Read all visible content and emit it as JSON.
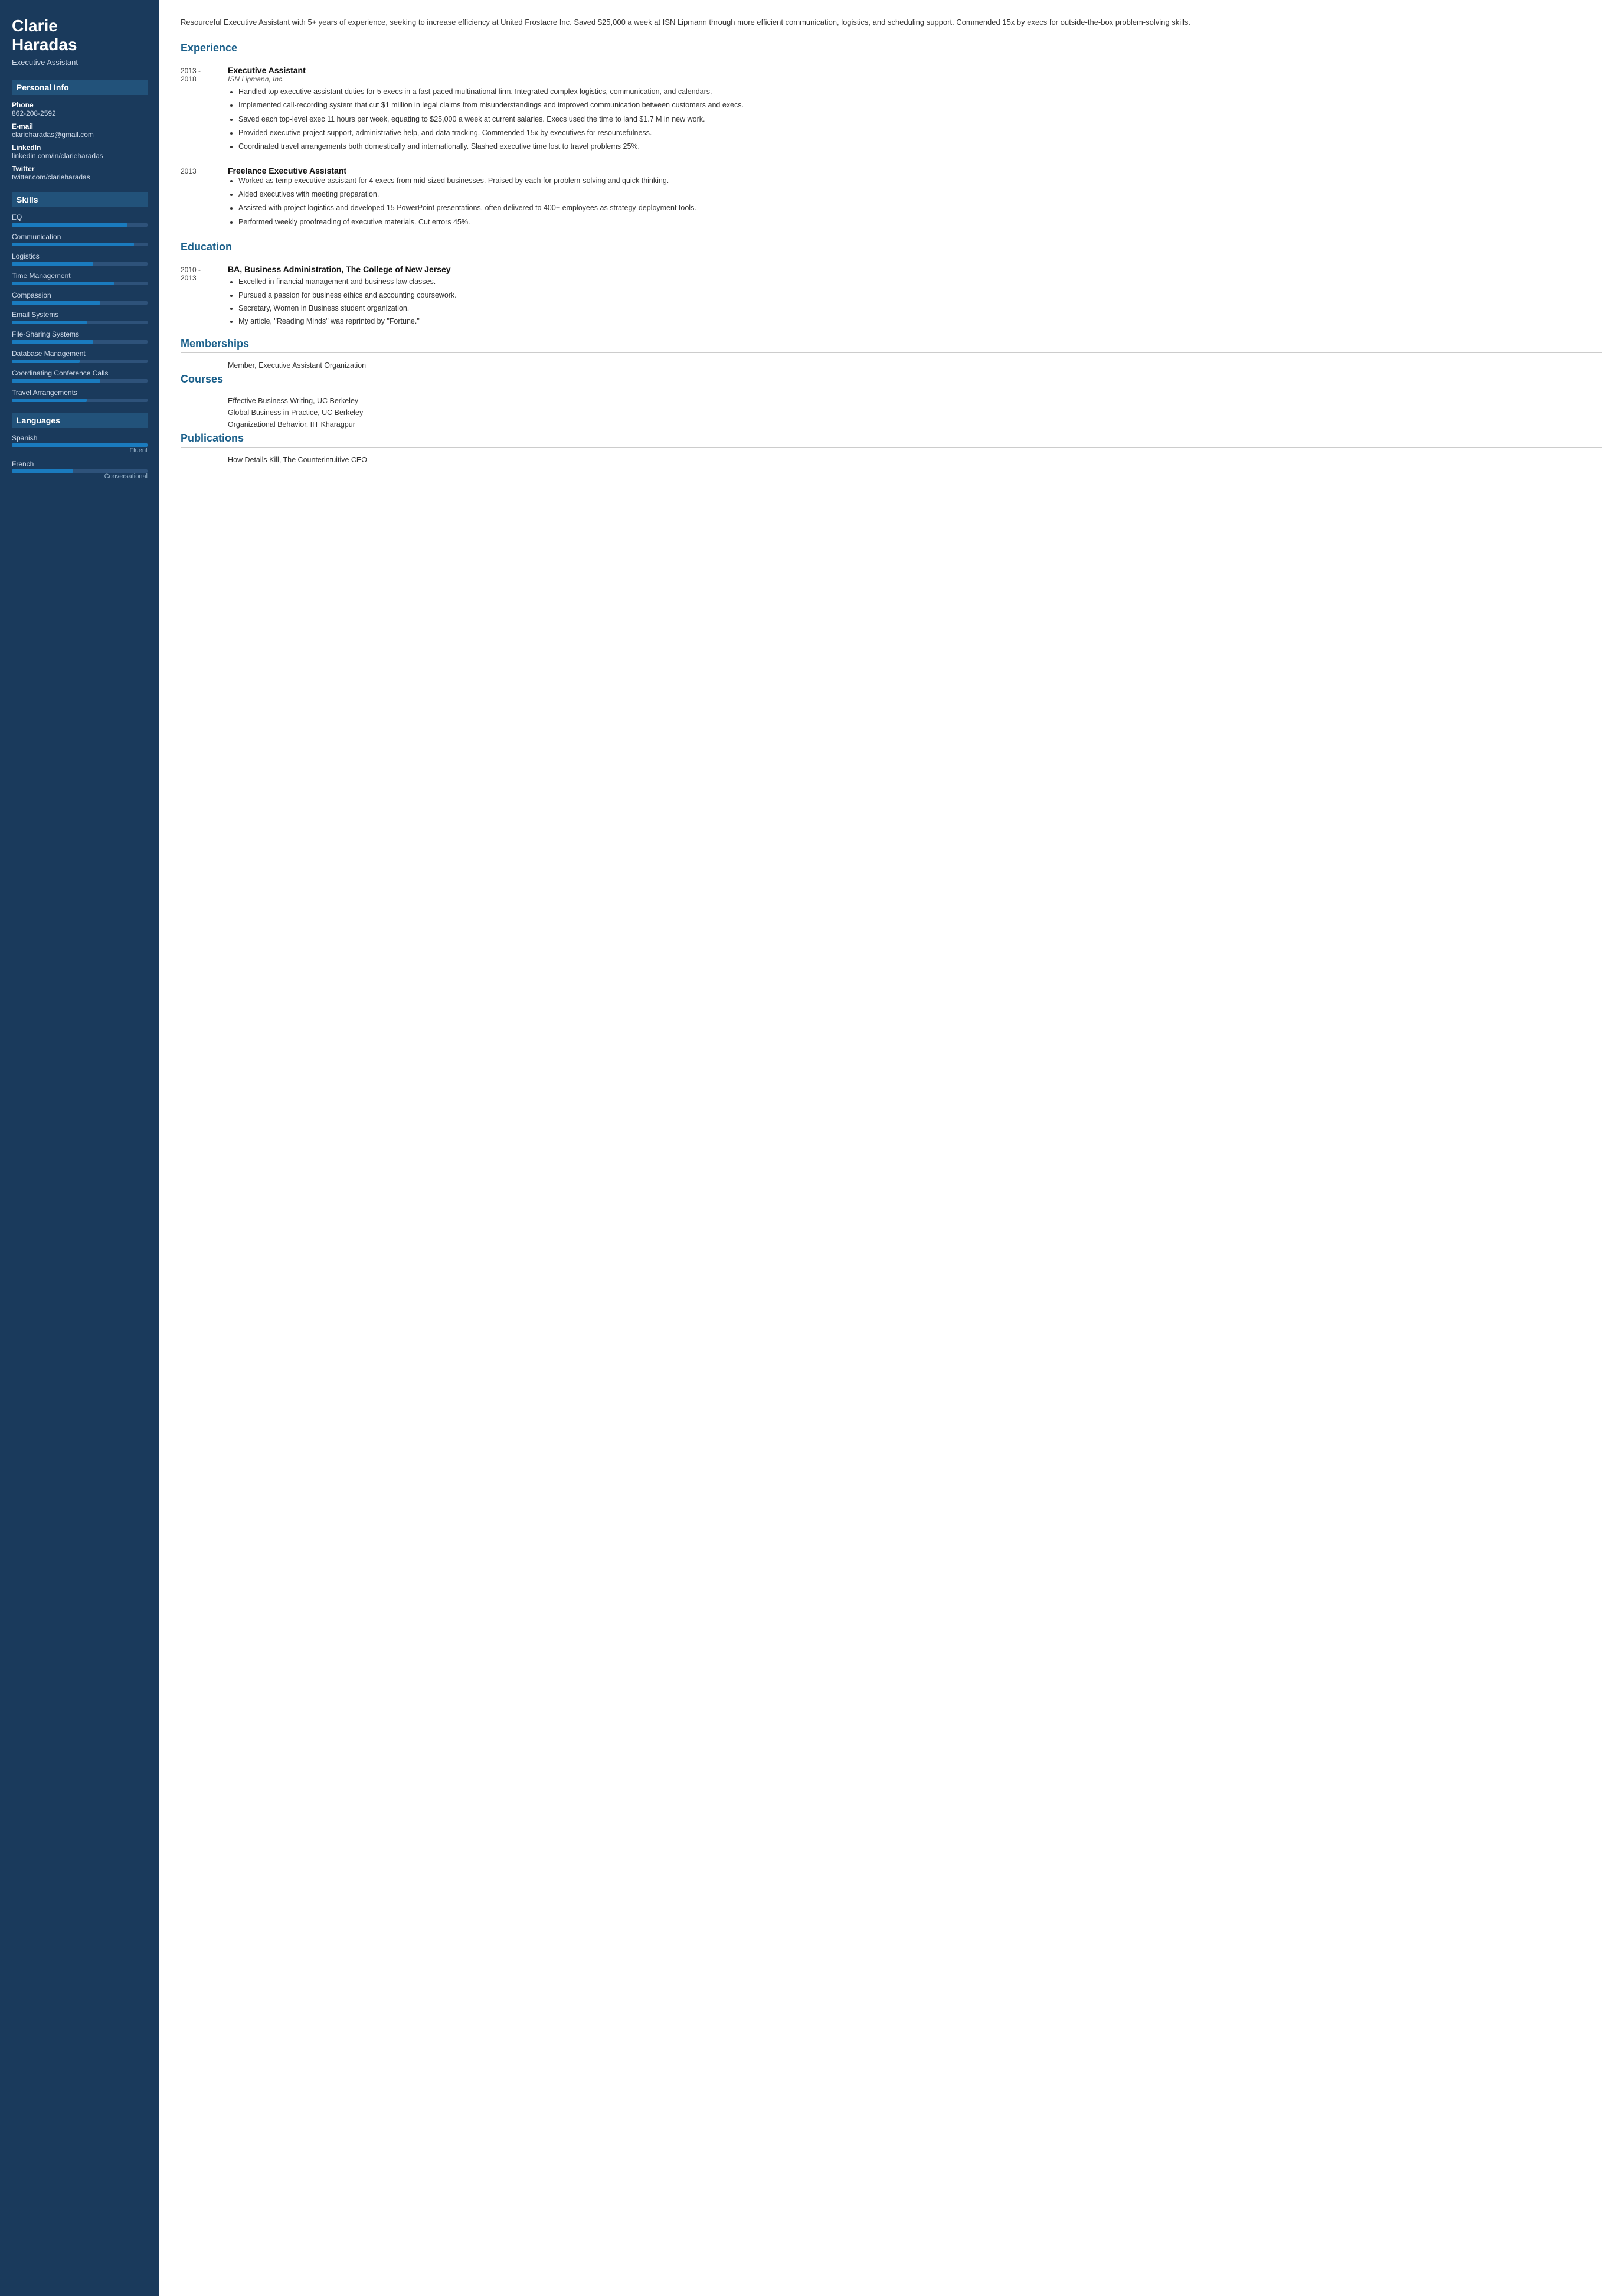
{
  "sidebar": {
    "name": "Clarie\nHaradas",
    "name_line1": "Clarie",
    "name_line2": "Haradas",
    "title": "Executive Assistant",
    "personal_info_label": "Personal Info",
    "phone_label": "Phone",
    "phone": "862-208-2592",
    "email_label": "E-mail",
    "email": "clarieharadas@gmail.com",
    "linkedin_label": "LinkedIn",
    "linkedin": "linkedin.com/in/clarieharadas",
    "twitter_label": "Twitter",
    "twitter": "twitter.com/clarieharadas",
    "skills_label": "Skills",
    "skills": [
      {
        "name": "EQ",
        "pct": 85
      },
      {
        "name": "Communication",
        "pct": 90
      },
      {
        "name": "Logistics",
        "pct": 60
      },
      {
        "name": "Time Management",
        "pct": 75
      },
      {
        "name": "Compassion",
        "pct": 65
      },
      {
        "name": "Email Systems",
        "pct": 55
      },
      {
        "name": "File-Sharing Systems",
        "pct": 60
      },
      {
        "name": "Database Management",
        "pct": 50
      },
      {
        "name": "Coordinating Conference Calls",
        "pct": 65
      },
      {
        "name": "Travel Arrangements",
        "pct": 55
      }
    ],
    "languages_label": "Languages",
    "languages": [
      {
        "name": "Spanish",
        "pct": 100,
        "level": "Fluent"
      },
      {
        "name": "French",
        "pct": 45,
        "level": "Conversational"
      }
    ]
  },
  "main": {
    "summary": "Resourceful Executive Assistant with 5+ years of experience, seeking to increase efficiency at United Frostacre Inc. Saved $25,000 a week at ISN Lipmann through more efficient communication, logistics, and scheduling support. Commended 15x by execs for outside-the-box problem-solving skills.",
    "experience_label": "Experience",
    "jobs": [
      {
        "date": "2013 -\n2018",
        "title": "Executive Assistant",
        "company": "ISN Lipmann, Inc.",
        "bullets": [
          "Handled top executive assistant duties for 5 execs in a fast-paced multinational firm. Integrated complex logistics, communication, and calendars.",
          "Implemented call-recording system that cut $1 million in legal claims from misunderstandings and improved communication between customers and execs.",
          "Saved each top-level exec 11 hours per week, equating to $25,000 a week at current salaries. Execs used the time to land $1.7 M in new work.",
          "Provided executive project support, administrative help, and data tracking. Commended 15x by executives for resourcefulness.",
          "Coordinated travel arrangements both domestically and internationally. Slashed executive time lost to travel problems 25%."
        ]
      },
      {
        "date": "2013",
        "title": "Freelance Executive Assistant",
        "company": "",
        "bullets": [
          "Worked as temp executive assistant for 4 execs from mid-sized businesses. Praised by each for problem-solving and quick thinking.",
          "Aided executives with meeting preparation.",
          "Assisted with project logistics and developed 15 PowerPoint presentations, often delivered to 400+ employees as strategy-deployment tools.",
          "Performed weekly proofreading of executive materials. Cut errors 45%."
        ]
      }
    ],
    "education_label": "Education",
    "education": [
      {
        "date": "2010 -\n2013",
        "degree": "BA, Business Administration, The College of New Jersey",
        "bullets": [
          "Excelled in financial management and business law classes.",
          "Pursued a passion for business ethics and accounting coursework.",
          "Secretary, Women in Business student organization.",
          "My article, \"Reading Minds\" was reprinted by \"Fortune.\""
        ]
      }
    ],
    "memberships_label": "Memberships",
    "memberships": [
      "Member, Executive Assistant Organization"
    ],
    "courses_label": "Courses",
    "courses": [
      "Effective Business Writing, UC Berkeley",
      "Global Business in Practice, UC Berkeley",
      "Organizational Behavior, IIT Kharagpur"
    ],
    "publications_label": "Publications",
    "publications": [
      "How Details Kill, The Counterintuitive CEO"
    ]
  }
}
